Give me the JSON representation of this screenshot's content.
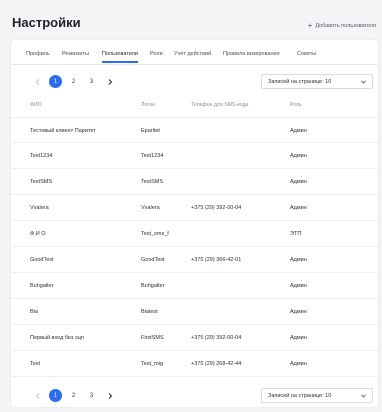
{
  "header": {
    "title": "Настройки",
    "add_user_label": "Добавить пользователя",
    "add_user_icon": "plus-icon"
  },
  "tabs": [
    {
      "label": "Профиль",
      "active": false
    },
    {
      "label": "Реквизиты",
      "active": false
    },
    {
      "label": "Пользователи",
      "active": true
    },
    {
      "label": "Роли",
      "active": false
    },
    {
      "label": "Учёт действий",
      "active": false
    },
    {
      "label": "Правила визирования",
      "active": false
    },
    {
      "label": "Советы",
      "active": false
    }
  ],
  "pagination": {
    "pages": [
      "1",
      "2",
      "3"
    ],
    "current": "1",
    "prev_icon": "chevron-left-icon",
    "next_icon": "chevron-right-icon"
  },
  "per_page": {
    "label": "Записей на странице: 10",
    "icon": "chevron-down-icon"
  },
  "table": {
    "columns": [
      "ФИО",
      "Логин",
      "Телефон для SMS-кода",
      "Роль"
    ],
    "rows": [
      {
        "name": "Тестовый клиент Паритет",
        "login": "Eparitet",
        "phone": "",
        "role": "Админ"
      },
      {
        "name": "Test1234",
        "login": "Test1234",
        "phone": "",
        "role": "Админ"
      },
      {
        "name": "TestSMS",
        "login": "TestSMS",
        "phone": "",
        "role": "Админ"
      },
      {
        "name": "Vvalera",
        "login": "Vvalera",
        "phone": "+375 (29) 392-00-04",
        "role": "Админ"
      },
      {
        "name": "Ф И О",
        "login": "Test_sms_f",
        "phone": "",
        "role": "ЭТП"
      },
      {
        "name": "GoodTest",
        "login": "GoodTest",
        "phone": "+375 (29) 366-42-01",
        "role": "Админ"
      },
      {
        "name": "Buhgalter",
        "login": "Buhgalter",
        "phone": "",
        "role": "Админ"
      },
      {
        "name": "Bia",
        "login": "Biatest",
        "phone": "",
        "role": "Админ"
      },
      {
        "name": "Первый вход без эцп",
        "login": "FirstSMS",
        "phone": "+375 (29) 392-00-04",
        "role": "Админ"
      },
      {
        "name": "Test",
        "login": "Test_mig",
        "phone": "+375 (29) 268-42-44",
        "role": "Админ"
      }
    ]
  },
  "colors": {
    "accent": "#2a6df4",
    "background": "#f3f4f6",
    "card": "#ffffff"
  }
}
